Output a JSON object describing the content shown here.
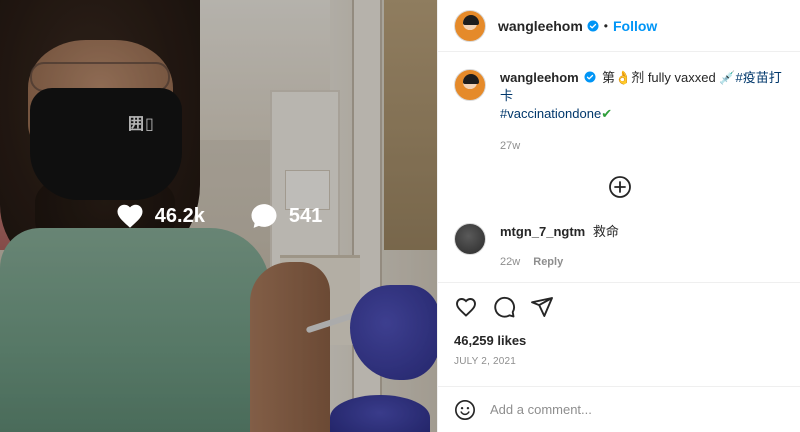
{
  "overlay": {
    "likes_count": "46.2k",
    "comments_count": "541"
  },
  "header": {
    "username": "wangleehom",
    "separator": "•",
    "follow_label": "Follow"
  },
  "caption": {
    "username": "wangleehom",
    "text_prefix": "第",
    "emoji_hand": "👌",
    "text_mid": "剂 fully vaxxed ",
    "emoji_syringe": "💉",
    "hashtag1": "#疫苗打卡",
    "hashtag2": "#vaccinationdone",
    "emoji_check": "✔",
    "time": "27w"
  },
  "comments": [
    {
      "username": "mtgn_7_ngtm",
      "text": "救命",
      "time": "22w",
      "reply_label": "Reply"
    }
  ],
  "stats": {
    "likes_text": "46,259 likes",
    "date": "JULY 2, 2021"
  },
  "comment_box": {
    "placeholder": "Add a comment..."
  },
  "colors": {
    "link": "#0095f6",
    "hashtag": "#00376b",
    "muted": "#8e8e8e",
    "check": "#2e9e3a"
  },
  "icons": [
    "heart-icon",
    "comment-icon",
    "share-icon",
    "plus-circle-icon",
    "emoji-icon",
    "verified-badge-icon"
  ]
}
